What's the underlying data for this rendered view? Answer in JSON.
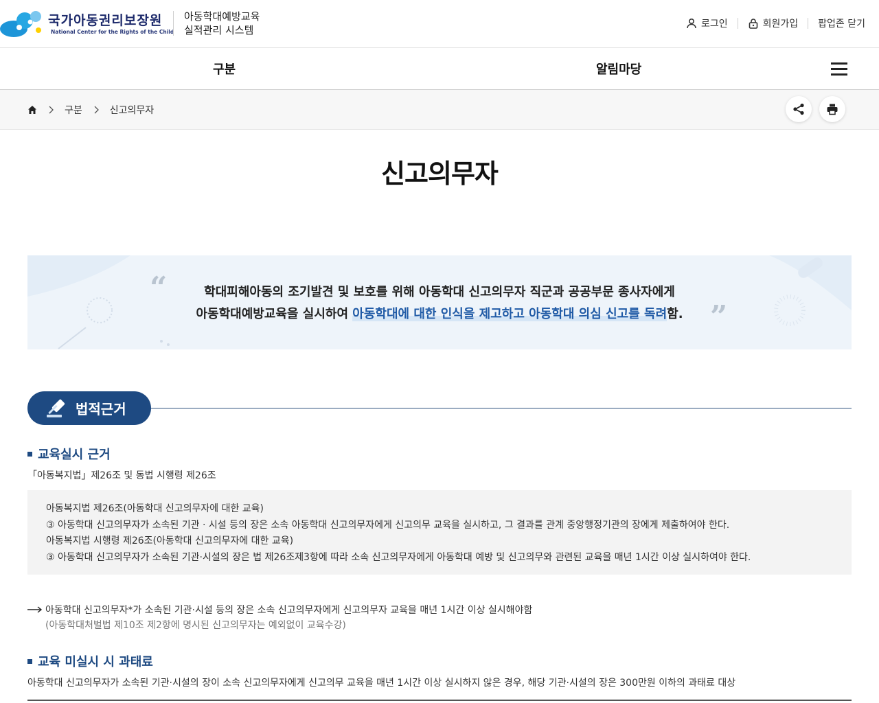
{
  "header": {
    "logo_ko": "국가아동권리보장원",
    "logo_en": "National Center for the Rights of the Child",
    "system_title_line1": "아동학대예방교육",
    "system_title_line2": "실적관리 시스템",
    "utils": {
      "login": "로그인",
      "signup": "회원가입",
      "popup_close": "팝업존 닫기"
    }
  },
  "gnb": {
    "items": [
      {
        "label": "구분"
      },
      {
        "label": "알림마당"
      }
    ]
  },
  "breadcrumb": {
    "items": [
      "구분",
      "신고의무자"
    ]
  },
  "page": {
    "title": "신고의무자"
  },
  "banner": {
    "line1": "학대피해아동의 조기발견 및 보호를 위해 아동학대 신고의무자 직군과 공공부문 종사자에게",
    "line2_prefix": "아동학대예방교육을 실시하여 ",
    "line2_highlight": "아동학대에 대한 인식을 제고하고 아동학대 의심 신고를 독려",
    "line2_suffix": "함."
  },
  "section": {
    "title": "법적근거",
    "sub1": {
      "title": "교육실시 근거",
      "basis": "「아동복지법」제26조 및 동법 시행령 제26조",
      "law_box": [
        "아동복지법 제26조(아동학대 신고의무자에 대한 교육)",
        "③ 아동학대 신고의무자가 소속된 기관 · 시설 등의 장은 소속 아동학대 신고의무자에게 신고의무 교육을 실시하고, 그 결과를 관계 중앙행정기관의 장에게 제출하여야 한다.",
        "아동복지법 시행령 제26조(아동학대 신고의무자에 대한 교육)",
        "③ 아동학대 신고의무자가 소속된 기관·시설의 장은 법 제26조제3항에 따라 소속 신고의무자에게 아동학대 예방 및 신고의무와 관련된 교육을 매년 1시간 이상 실시하여야 한다."
      ],
      "arrow_text": "아동학대 신고의무자*가 소속된 기관·시설 등의 장은 소속 신고의무자에게 신고의무자 교육을 매년 1시간 이상 실시해야함",
      "arrow_note": "(아동학대처벌법 제10조 제2항에 명시된 신고의무자는 예외없이 교육수강)"
    },
    "sub2": {
      "title": "교육 미실시 시 과태료",
      "text": "아동학대 신고의무자가 소속된 기관·시설의 장이 소속 신고의무자에게 신고의무 교육을 매년 1시간 이상 실시하지 않은 경우, 해당 기관·시설의 장은 300만원 이하의 과태료 대상"
    }
  },
  "colors": {
    "primary": "#1e4a82",
    "highlight": "#1f5aa6",
    "banner_bg": "#eef4fa"
  },
  "icons": {
    "login": "person-icon",
    "signup": "lock-icon",
    "menu": "hamburger-icon",
    "home": "home-icon",
    "share": "share-icon",
    "print": "printer-icon",
    "section": "gavel-icon"
  }
}
